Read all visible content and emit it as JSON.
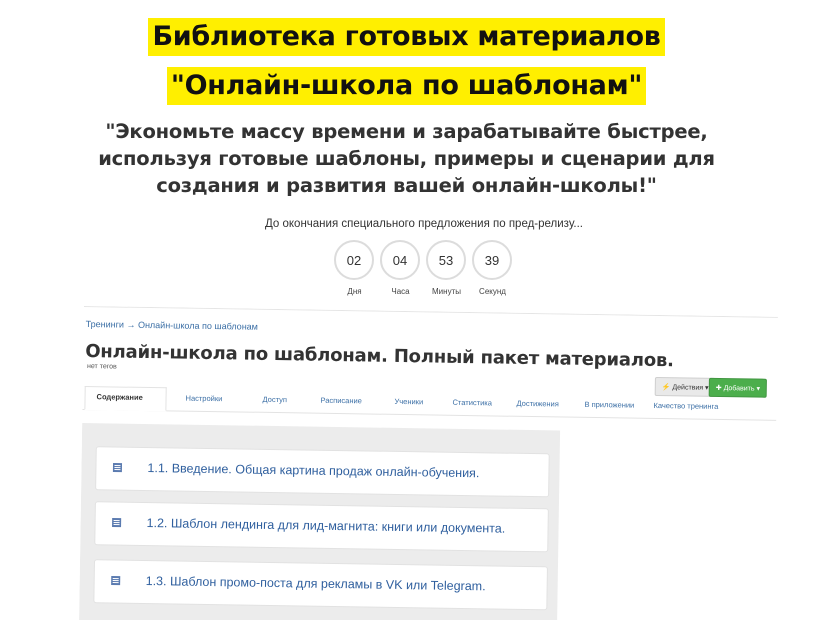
{
  "headline": {
    "line1": "Библиотека готовых материалов",
    "line2": "\"Онлайн-школа по шаблонам\""
  },
  "quote": {
    "line1": "\"Экономьте массу времени и зарабатывайте быстрее,",
    "line2": "используя готовые шаблоны, примеры и сценарии для",
    "line3": "создания и развития вашей онлайн-школы!\""
  },
  "countdown": {
    "caption": "До окончания специального предложения по пред-релизу...",
    "units": [
      {
        "value": "02",
        "label": "Дня"
      },
      {
        "value": "04",
        "label": "Часа"
      },
      {
        "value": "53",
        "label": "Минуты"
      },
      {
        "value": "39",
        "label": "Секунд"
      }
    ]
  },
  "screenshot": {
    "breadcrumb": "Тренинги → Онлайн-школа по шаблонам",
    "title": "Онлайн-школа по шаблонам. Полный пакет материалов.",
    "tags": "нет тегов",
    "actions_label": "⚡ Действия ▾",
    "add_label": "✚ Добавить ▾",
    "tabs": [
      {
        "label": "Содержание"
      },
      {
        "label": "Настройки"
      },
      {
        "label": "Доступ"
      },
      {
        "label": "Расписание"
      },
      {
        "label": "Ученики"
      },
      {
        "label": "Статистика"
      },
      {
        "label": "Достижения"
      },
      {
        "label": "В приложении"
      },
      {
        "label": "Качество тренинга"
      }
    ],
    "lessons": [
      {
        "title": "1.1. Введение. Общая картина продаж онлайн-обучения.",
        "icon": "document-icon"
      },
      {
        "title": "1.2. Шаблон лендинга для лид-магнита: книги или документа.",
        "icon": "document-icon"
      },
      {
        "title": "1.3. Шаблон промо-поста для рекламы в VK или Telegram.",
        "icon": "document-icon"
      }
    ]
  },
  "colors": {
    "highlight": "#ffef00",
    "link": "#3a6ea5",
    "add_button": "#4cae4c"
  }
}
